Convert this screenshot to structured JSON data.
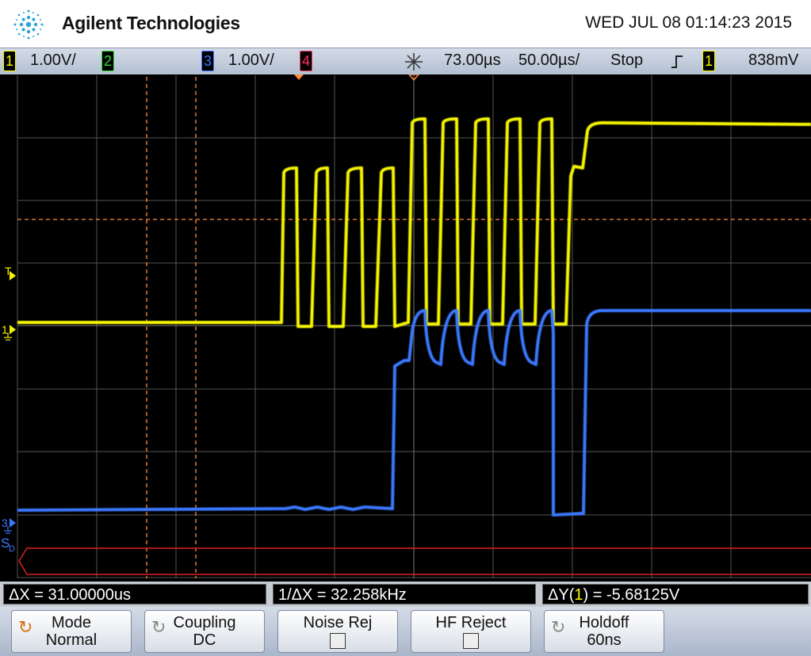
{
  "header": {
    "brand": "Agilent Technologies",
    "datetime": "WED JUL 08 01:14:23 2015"
  },
  "status": {
    "ch1_num": "1",
    "ch1_scale": "1.00V/",
    "ch2_num": "2",
    "ch3_num": "3",
    "ch3_scale": "1.00V/",
    "ch4_num": "4",
    "trigger_delay": "73.00µs",
    "timebase": "50.00µs/",
    "run_state": "Stop",
    "trig_slope_icon": "rising-edge-icon",
    "trig_source": "1",
    "trig_level": "838mV",
    "colors": {
      "ch1": "#f5f500",
      "ch2": "#2ee02e",
      "ch3": "#3b78ff",
      "ch4": "#ff3060",
      "cursor": "#ff8a3c"
    }
  },
  "screen": {
    "marker_t": "T",
    "marker_ch1": "1",
    "marker_ch3": "3",
    "marker_sd": "S",
    "marker_sd_sub": "D"
  },
  "measurements": {
    "dx": "ΔX = 31.00000us",
    "inv_dx": "1/ΔX = 32.258kHz",
    "dy_prefix": "ΔY(",
    "dy_ch": "1",
    "dy_suffix": ") = -5.68125V"
  },
  "softkeys": {
    "mode_title": "Mode",
    "mode_value": "Normal",
    "coupling_title": "Coupling",
    "coupling_value": "DC",
    "noise_title": "Noise Rej",
    "hf_title": "HF Reject",
    "holdoff_title": "Holdoff",
    "holdoff_value": "60ns"
  }
}
